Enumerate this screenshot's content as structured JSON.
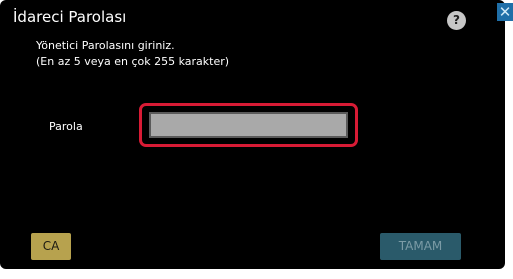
{
  "dialog": {
    "title": "İdareci Parolası",
    "help_icon": "question-mark-icon",
    "close_icon": "close-x-icon",
    "close_glyph": "✕",
    "help_glyph": "?",
    "instruction_line1": "Yönetici Parolasını giriniz.",
    "instruction_line2": "(En az 5 veya en çok 255 karakter)",
    "password": {
      "label": "Parola",
      "value": "",
      "placeholder": ""
    },
    "buttons": {
      "ca_label": "CA",
      "ok_label": "TAMAM"
    }
  },
  "colors": {
    "dialog_background": "#000000",
    "input_highlight": "#d81b35",
    "input_fill": "#a9a9a9",
    "ca_button": "#b7a24e",
    "ok_button": "#2a5a6a",
    "close_button": "#1f6fa8"
  }
}
